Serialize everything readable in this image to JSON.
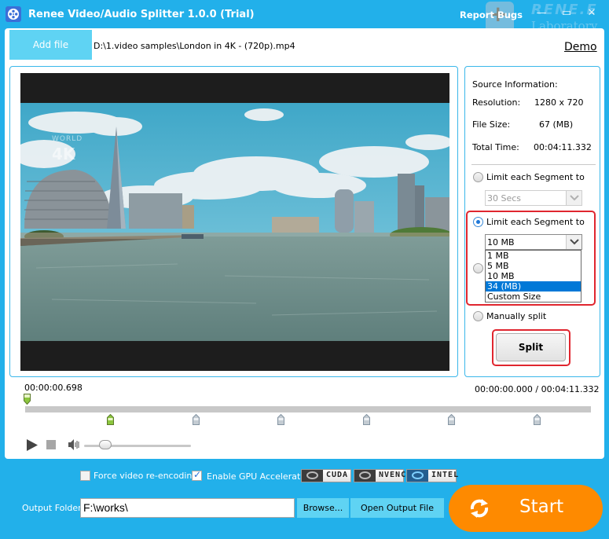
{
  "window": {
    "title": "Renee Video/Audio Splitter 1.0.0 (Trial)",
    "report_bugs": "Report Bugs",
    "minimize_icon": "minimize-icon",
    "maximize_icon": "maximize-icon",
    "close_icon": "close-icon",
    "watermark_brand": "RENE.E",
    "watermark_sub": "Laboratory"
  },
  "toolbar": {
    "add_file_label": "Add file",
    "file_path": "D:\\1.video samples\\London in 4K - (720p).mp4",
    "demo_label": "Demo"
  },
  "video": {
    "overlay_logo": "WORLD 4K"
  },
  "source_info": {
    "heading": "Source Information:",
    "resolution_label": "Resolution:",
    "resolution_value": "1280 x 720",
    "file_size_label": "File Size:",
    "file_size_value": "67 (MB)",
    "total_time_label": "Total Time:",
    "total_time_value": "00:04:11.332"
  },
  "split_options": {
    "option_time": {
      "label": "Limit each Segment to",
      "selected": false,
      "combo_value": "30 Secs",
      "enabled": false
    },
    "option_size": {
      "label": "Limit each Segment to",
      "selected": true,
      "combo_value": "10 MB",
      "dropdown_open": true,
      "options": [
        "1 MB",
        "5 MB",
        "10 MB",
        "34 (MB)",
        "Custom Size"
      ],
      "highlighted_option": "34 (MB)"
    },
    "option_hidden": {
      "selected": false
    },
    "option_manual": {
      "label": "Manually split",
      "selected": false
    },
    "split_button_label": "Split"
  },
  "timeline": {
    "current_marker_time": "00:00:00.698",
    "position_display": "00:00:00.000 / 00:04:11.332",
    "segment_marker_count": 6,
    "active_segment_marker_index": 0,
    "volume_percent": 20
  },
  "playback": {
    "play_icon": "play-icon",
    "stop_icon": "stop-icon",
    "volume_icon": "volume-icon"
  },
  "options": {
    "force_reencode_label": "Force video re-encoding",
    "force_reencode_checked": false,
    "gpu_accel_label": "Enable GPU Acceleration",
    "gpu_accel_checked": true,
    "gpu_badges": [
      "CUDA",
      "NVENC",
      "INTEL"
    ]
  },
  "output": {
    "folder_label": "Output Folder:",
    "folder_value": "F:\\works\\",
    "browse_label": "Browse...",
    "open_output_label": "Open Output File",
    "start_label": "Start"
  },
  "colors": {
    "frame_blue": "#22b0ea",
    "button_cyan": "#5fd3f3",
    "start_orange": "#fe8a00",
    "highlight_red": "#e0262f",
    "selection_blue": "#0078d7",
    "marker_green": "#8cc63f"
  }
}
